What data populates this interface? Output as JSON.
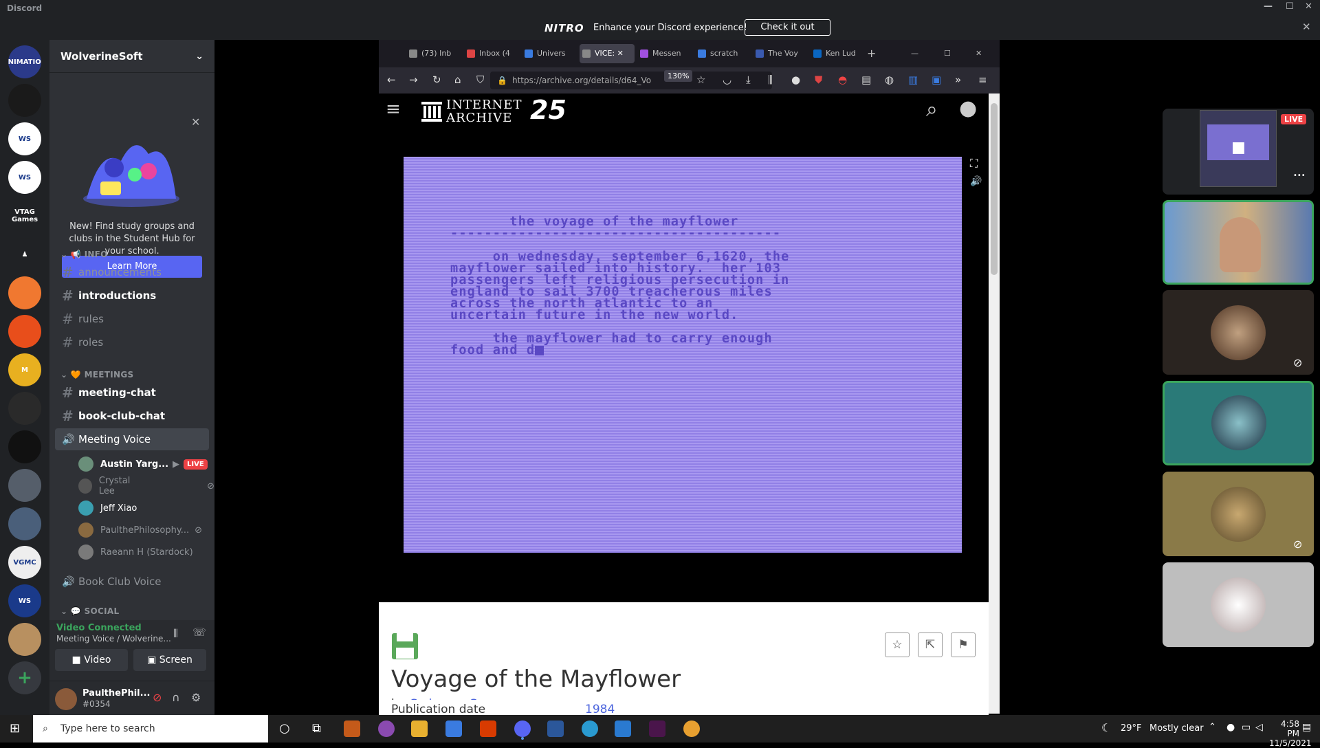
{
  "window": {
    "app_name": "Discord",
    "minimize": "—",
    "maximize": "☐",
    "close": "✕"
  },
  "nitro": {
    "logo": "NITRO",
    "message": "Enhance your Discord experience!",
    "cta": "Check it out",
    "close": "✕"
  },
  "server": {
    "name": "WolverineSoft"
  },
  "rail": {
    "servers": [
      {
        "name": "ANIMATION",
        "color": "#2b3a8a"
      },
      {
        "name": "",
        "color": "#1a1a1a"
      },
      {
        "name": "WS",
        "color": "#ffffff"
      },
      {
        "name": "WS",
        "color": "#ffffff"
      },
      {
        "name": "VTAG Games",
        "color": "#202225"
      },
      {
        "name": "♟",
        "color": "#202225"
      },
      {
        "name": "",
        "color": "#f07830"
      },
      {
        "name": "",
        "color": "#e84e1b"
      },
      {
        "name": "M",
        "color": "#e8b020"
      },
      {
        "name": "",
        "color": "#2a2a2a"
      },
      {
        "name": "",
        "color": "#111111"
      },
      {
        "name": "",
        "color": "#555e6a"
      },
      {
        "name": "",
        "color": "#4a5f7a"
      },
      {
        "name": "VGMC",
        "color": "#eeeeee"
      },
      {
        "name": "WS",
        "color": "#1a3a8a"
      },
      {
        "name": "",
        "color": "#b89060"
      }
    ]
  },
  "hub": {
    "text": "New! Find study groups and clubs in the Student Hub for your school.",
    "button": "Learn More",
    "close": "✕"
  },
  "categories": {
    "info": "INFO",
    "meetings": "MEETINGS",
    "social": "SOCIAL"
  },
  "channels": {
    "announcements": "announcements",
    "introductions": "introductions",
    "rules": "rules",
    "roles": "roles",
    "meeting_chat": "meeting-chat",
    "book_club_chat": "book-club-chat",
    "meeting_voice": "Meeting Voice",
    "book_club_voice": "Book Club Voice"
  },
  "voice_users": [
    {
      "name": "Austin Yarg...",
      "live": "LIVE",
      "color": "#6a8f7a"
    },
    {
      "name": "Crystal Lee",
      "color": "#555555"
    },
    {
      "name": "Jeff Xiao",
      "color": "#3a9fb0"
    },
    {
      "name": "PaulthePhilosophy...",
      "color": "#8a6a40"
    },
    {
      "name": "Raeann H (Stardock)",
      "color": "#7a7a7a"
    }
  ],
  "voice": {
    "status": "Video Connected",
    "location": "Meeting Voice / Wolverine...",
    "video": "Video",
    "screen": "Screen"
  },
  "user": {
    "name": "PaulthePhil...",
    "tag": "#0354"
  },
  "browser": {
    "tabs": [
      {
        "label": "(73) Inb",
        "color": "#888"
      },
      {
        "label": "Inbox (4",
        "color": "#d44"
      },
      {
        "label": "Univers",
        "color": "#3a7be0"
      },
      {
        "label": "VICE:",
        "color": "#888"
      },
      {
        "label": "Messen",
        "color": "#a050e0"
      },
      {
        "label": "scratch",
        "color": "#3a7be0"
      },
      {
        "label": "The Voy",
        "color": "#3a5ab0"
      },
      {
        "label": "Ken Lud",
        "color": "#0a66c2"
      }
    ],
    "new_tab": "+",
    "url": "https://archive.org/details/d64_Vo",
    "zoom": "130%"
  },
  "ia": {
    "title_line1": "INTERNET",
    "title_line2": "ARCHIVE",
    "number": "25"
  },
  "emulator": {
    "lines": [
      "       the voyage of the mayflower",
      "---------------------------------------",
      "",
      "     on wednesday, september 6,1620, the",
      "mayflower sailed into history.  her 103",
      "passengers left religious persecution in",
      "england to sail 3700 treacherous miles",
      "across the north atlantic to an",
      "uncertain future in the new world.",
      "",
      "     the mayflower had to carry enough",
      "food and d"
    ]
  },
  "item": {
    "title": "Voyage of the Mayflower",
    "by_prefix": "by ",
    "author": "Cadmean Corp.",
    "pub_label": "Publication date",
    "pub_value": "1984"
  },
  "tiles": {
    "live": "LIVE",
    "more": "•••"
  },
  "taskbar": {
    "search_placeholder": "Type here to search",
    "weather_temp": "29°F",
    "weather_desc": "Mostly clear",
    "time": "4:58 PM",
    "date": "11/5/2021"
  }
}
